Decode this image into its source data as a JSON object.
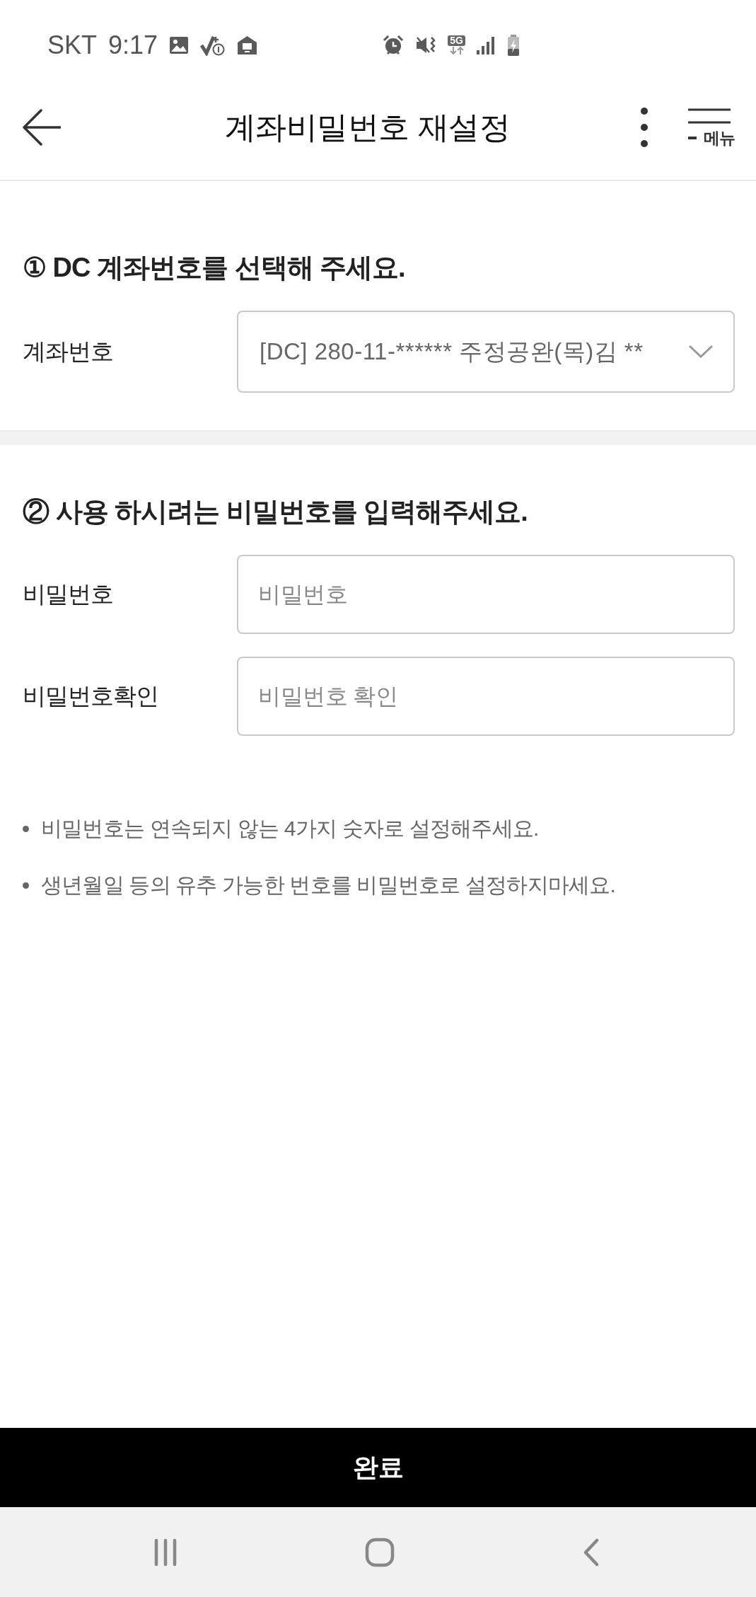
{
  "status_bar": {
    "carrier": "SKT",
    "time": "9:17",
    "network": "5G"
  },
  "header": {
    "title": "계좌비밀번호 재설정",
    "menu_label": "메뉴"
  },
  "sections": [
    {
      "title": "① DC 계좌번호를 선택해 주세요.",
      "fields": [
        {
          "kind": "select",
          "label": "계좌번호",
          "value": "[DC] 280-11-****** 주정공완(목)김 **"
        }
      ]
    },
    {
      "title": "② 사용 하시려는 비밀번호를 입력해주세요.",
      "fields": [
        {
          "kind": "input",
          "label": "비밀번호",
          "placeholder": "비밀번호"
        },
        {
          "kind": "input",
          "label": "비밀번호확인",
          "placeholder": "비밀번호 확인"
        }
      ]
    }
  ],
  "notes": [
    "비밀번호는 연속되지 않는 4가지 숫자로 설정해주세요.",
    "생년월일 등의 유추 가능한 번호를 비밀번호로 설정하지마세요."
  ],
  "submit": {
    "label": "완료"
  }
}
